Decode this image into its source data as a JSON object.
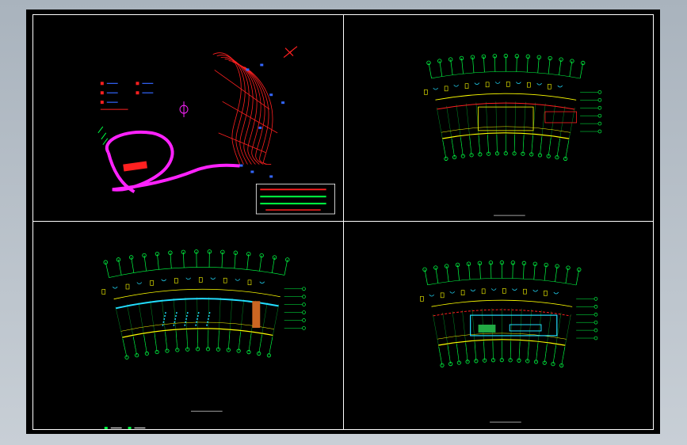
{
  "window": {
    "title": "",
    "background_color": "#b4bdc6"
  },
  "viewports": [
    {
      "id": "site-plan",
      "type": "site-plan"
    },
    {
      "id": "plan-1",
      "type": "floor-plan"
    },
    {
      "id": "plan-2",
      "type": "floor-plan"
    },
    {
      "id": "plan-3",
      "type": "floor-plan"
    }
  ],
  "colors": {
    "sheet": "#000000",
    "frame": "#ffffff",
    "axis_bubbles": "#00ff44",
    "walls": "#ffff00",
    "red_lines": "#ff2020",
    "magenta_road": "#ff22ff",
    "cyan_lines": "#22ddff",
    "blue_marks": "#3366ff"
  }
}
